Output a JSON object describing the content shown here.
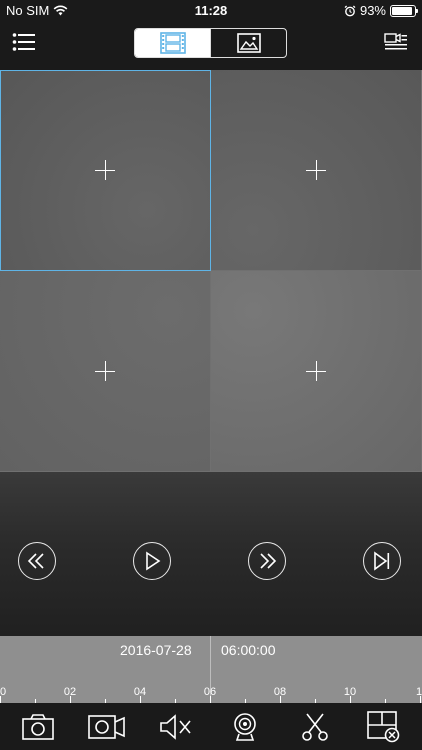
{
  "status_bar": {
    "carrier": "No SIM",
    "time": "11:28",
    "battery_percent": "93%",
    "battery_level": 0.93
  },
  "nav": {
    "menu_icon": "list-menu-icon",
    "segments": [
      {
        "icon": "film-strip-icon",
        "active": true
      },
      {
        "icon": "picture-icon",
        "active": false
      }
    ],
    "device_icon": "camera-list-icon"
  },
  "grid": {
    "cells": [
      {
        "selected": true,
        "icon": "plus-icon"
      },
      {
        "selected": false,
        "icon": "plus-icon"
      },
      {
        "selected": false,
        "icon": "plus-icon"
      },
      {
        "selected": false,
        "icon": "plus-icon"
      }
    ],
    "accent_color": "#5fb4e6"
  },
  "playback_controls": [
    {
      "name": "rewind",
      "icon": "rewind-icon"
    },
    {
      "name": "play",
      "icon": "play-icon"
    },
    {
      "name": "fast-forward",
      "icon": "fast-forward-icon"
    },
    {
      "name": "next-frame",
      "icon": "next-frame-icon"
    }
  ],
  "timeline": {
    "date": "2016-07-28",
    "time": "06:00:00",
    "labels": [
      "0",
      "02",
      "04",
      "06",
      "08",
      "10",
      "1"
    ]
  },
  "toolbar": [
    {
      "name": "snapshot",
      "icon": "camera-icon"
    },
    {
      "name": "record",
      "icon": "video-camera-icon"
    },
    {
      "name": "mute",
      "icon": "speaker-muted-icon"
    },
    {
      "name": "fisheye",
      "icon": "fisheye-icon"
    },
    {
      "name": "clip",
      "icon": "scissors-icon"
    },
    {
      "name": "close-all",
      "icon": "close-window-icon"
    }
  ]
}
